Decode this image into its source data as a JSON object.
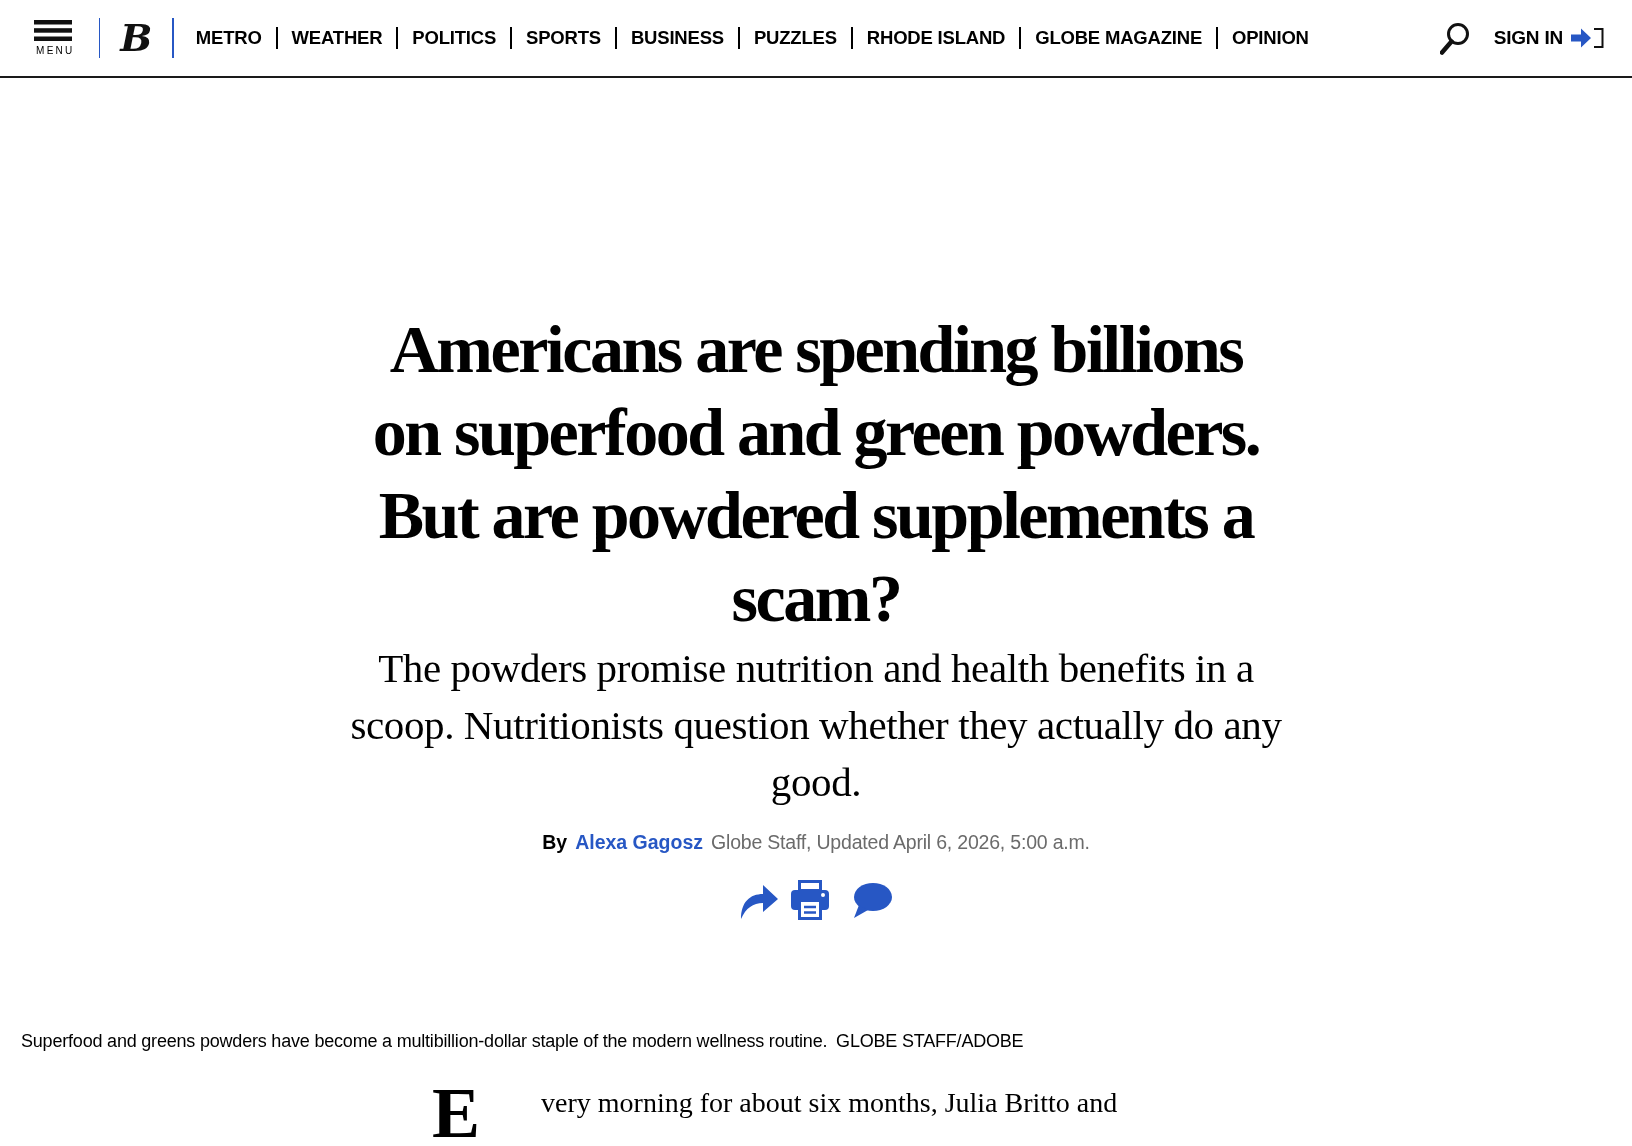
{
  "header": {
    "menu_label": "MENU",
    "logo": "B",
    "nav": [
      "METRO",
      "WEATHER",
      "POLITICS",
      "SPORTS",
      "BUSINESS",
      "PUZZLES",
      "RHODE ISLAND",
      "GLOBE MAGAZINE",
      "OPINION"
    ],
    "sign_in": "SIGN IN"
  },
  "article": {
    "headline": "Americans are spending billions on superfood and green powders. But are powdered supplements a scam?",
    "subheadline": "The powders promise nutrition and health benefits in a scoop. Nutritionists question whether they actually do any good.",
    "byline": {
      "prefix": "By",
      "author": "Alexa Gagosz",
      "meta": "Globe Staff, Updated April 6, 2026, 5:00 a.m."
    }
  },
  "image": {
    "caption": "Superfood and greens powders have become a multibillion-dollar staple of the modern wellness routine.",
    "credit": "GLOBE STAFF/ADOBE"
  },
  "body": {
    "drop_cap": "E",
    "first_line": "very morning for about six months, Julia Britto and"
  }
}
